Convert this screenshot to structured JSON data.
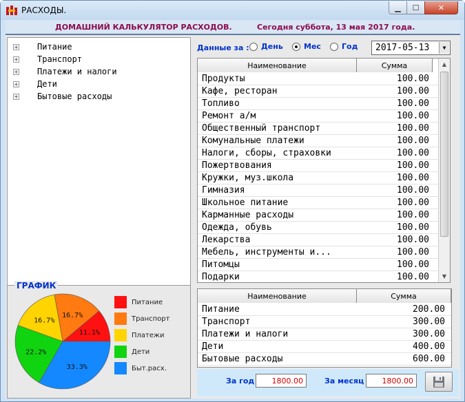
{
  "window": {
    "title": "РАСХОДЫ."
  },
  "header": {
    "app_name": "ДОМАШНИЙ КАЛЬКУЛЯТОР РАСХОДОВ.",
    "today": "Сегодня суббота, 13 мая 2017 года."
  },
  "tree": {
    "items": [
      "Питание",
      "Транспорт",
      "Платежи и налоги",
      "Дети",
      "Бытовые расходы"
    ]
  },
  "chart": {
    "title": "ГРАФИК",
    "colors": [
      "#ff1111",
      "#ff7a10",
      "#ffd400",
      "#11d411",
      "#1488ff"
    ],
    "legend": [
      "Питание",
      "Транспорт",
      "Платежи",
      "Дети",
      "Быт.расх."
    ]
  },
  "chart_data": {
    "type": "pie",
    "title": "ГРАФИК",
    "categories": [
      "Питание",
      "Транспорт",
      "Платежи",
      "Дети",
      "Быт.расх."
    ],
    "values": [
      11.1,
      16.7,
      16.7,
      22.2,
      33.3
    ],
    "labels": [
      "11.1%",
      "16.7%",
      "16.7%",
      "22.2%",
      "33.3%"
    ],
    "legend_position": "right"
  },
  "period": {
    "label": "Данные за :",
    "options": [
      "День",
      "Мес",
      "Год"
    ],
    "selected": "Мес",
    "date": "2017-05-13"
  },
  "items_table": {
    "columns": [
      "Наименование",
      "Сумма"
    ],
    "rows": [
      {
        "name": "Продукты",
        "sum": "100.00"
      },
      {
        "name": "Кафе, ресторан",
        "sum": "100.00"
      },
      {
        "name": "Топливо",
        "sum": "100.00"
      },
      {
        "name": "Ремонт а/м",
        "sum": "100.00"
      },
      {
        "name": "Общественный транспорт",
        "sum": "100.00"
      },
      {
        "name": "Комунальные платежи",
        "sum": "100.00"
      },
      {
        "name": "Налоги, сборы, страховки",
        "sum": "100.00"
      },
      {
        "name": "Пожертвования",
        "sum": "100.00"
      },
      {
        "name": "Кружки, муз.школа",
        "sum": "100.00"
      },
      {
        "name": "Гимназия",
        "sum": "100.00"
      },
      {
        "name": "Школьное питание",
        "sum": "100.00"
      },
      {
        "name": "Карманные расходы",
        "sum": "100.00"
      },
      {
        "name": "Одежда, обувь",
        "sum": "100.00"
      },
      {
        "name": "Лекарства",
        "sum": "100.00"
      },
      {
        "name": "Мебель, инструменты и...",
        "sum": "100.00"
      },
      {
        "name": "Питомцы",
        "sum": "100.00"
      },
      {
        "name": "Подарки",
        "sum": "100.00"
      }
    ]
  },
  "summary_table": {
    "columns": [
      "Наименование",
      "Сумма"
    ],
    "rows": [
      {
        "name": "Питание",
        "sum": "200.00"
      },
      {
        "name": "Транспорт",
        "sum": "300.00"
      },
      {
        "name": "Платежи и налоги",
        "sum": "300.00"
      },
      {
        "name": "Дети",
        "sum": "400.00"
      },
      {
        "name": "Бытовые расходы",
        "sum": "600.00"
      }
    ]
  },
  "totals": {
    "year_label": "За год",
    "year_value": "1800.00",
    "month_label": "За месяц",
    "month_value": "1800.00"
  },
  "icons": {
    "app": "app-logo-icon",
    "save": "floppy-disk-icon",
    "expand": "plus-box-icon"
  }
}
